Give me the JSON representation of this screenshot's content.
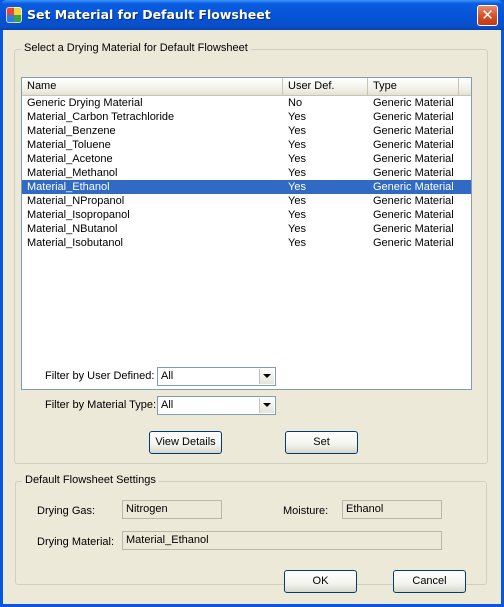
{
  "window": {
    "title": "Set Material for Default Flowsheet",
    "close_glyph": "✕"
  },
  "material_group": {
    "title": "Select a Drying Material for Default Flowsheet",
    "columns": [
      "Name",
      "User Def.",
      "Type"
    ],
    "rows": [
      {
        "name": "Generic Drying Material",
        "user_def": "No",
        "type": "Generic Material"
      },
      {
        "name": "Material_Carbon Tetrachloride",
        "user_def": "Yes",
        "type": "Generic Material"
      },
      {
        "name": "Material_Benzene",
        "user_def": "Yes",
        "type": "Generic Material"
      },
      {
        "name": "Material_Toluene",
        "user_def": "Yes",
        "type": "Generic Material"
      },
      {
        "name": "Material_Acetone",
        "user_def": "Yes",
        "type": "Generic Material"
      },
      {
        "name": "Material_Methanol",
        "user_def": "Yes",
        "type": "Generic Material"
      },
      {
        "name": "Material_Ethanol",
        "user_def": "Yes",
        "type": "Generic Material"
      },
      {
        "name": "Material_NPropanol",
        "user_def": "Yes",
        "type": "Generic Material"
      },
      {
        "name": "Material_Isopropanol",
        "user_def": "Yes",
        "type": "Generic Material"
      },
      {
        "name": "Material_NButanol",
        "user_def": "Yes",
        "type": "Generic Material"
      },
      {
        "name": "Material_Isobutanol",
        "user_def": "Yes",
        "type": "Generic Material"
      }
    ],
    "selected_row": "Material_Ethanol",
    "filter_user_label": "Filter by User Defined:",
    "filter_user_value": "All",
    "filter_type_label": "Filter by Material Type:",
    "filter_type_value": "All",
    "view_details_label": "View Details",
    "set_label": "Set"
  },
  "settings_group": {
    "title": "Default Flowsheet Settings",
    "drying_gas_label": "Drying Gas:",
    "drying_gas_value": "Nitrogen",
    "moisture_label": "Moisture:",
    "moisture_value": "Ethanol",
    "drying_material_label": "Drying Material:",
    "drying_material_value": "Material_Ethanol"
  },
  "footer": {
    "ok_label": "OK",
    "cancel_label": "Cancel"
  },
  "colors": {
    "titlebar": "#0453d6",
    "selection": "#316ac5",
    "dialog_bg": "#ece9d8"
  }
}
